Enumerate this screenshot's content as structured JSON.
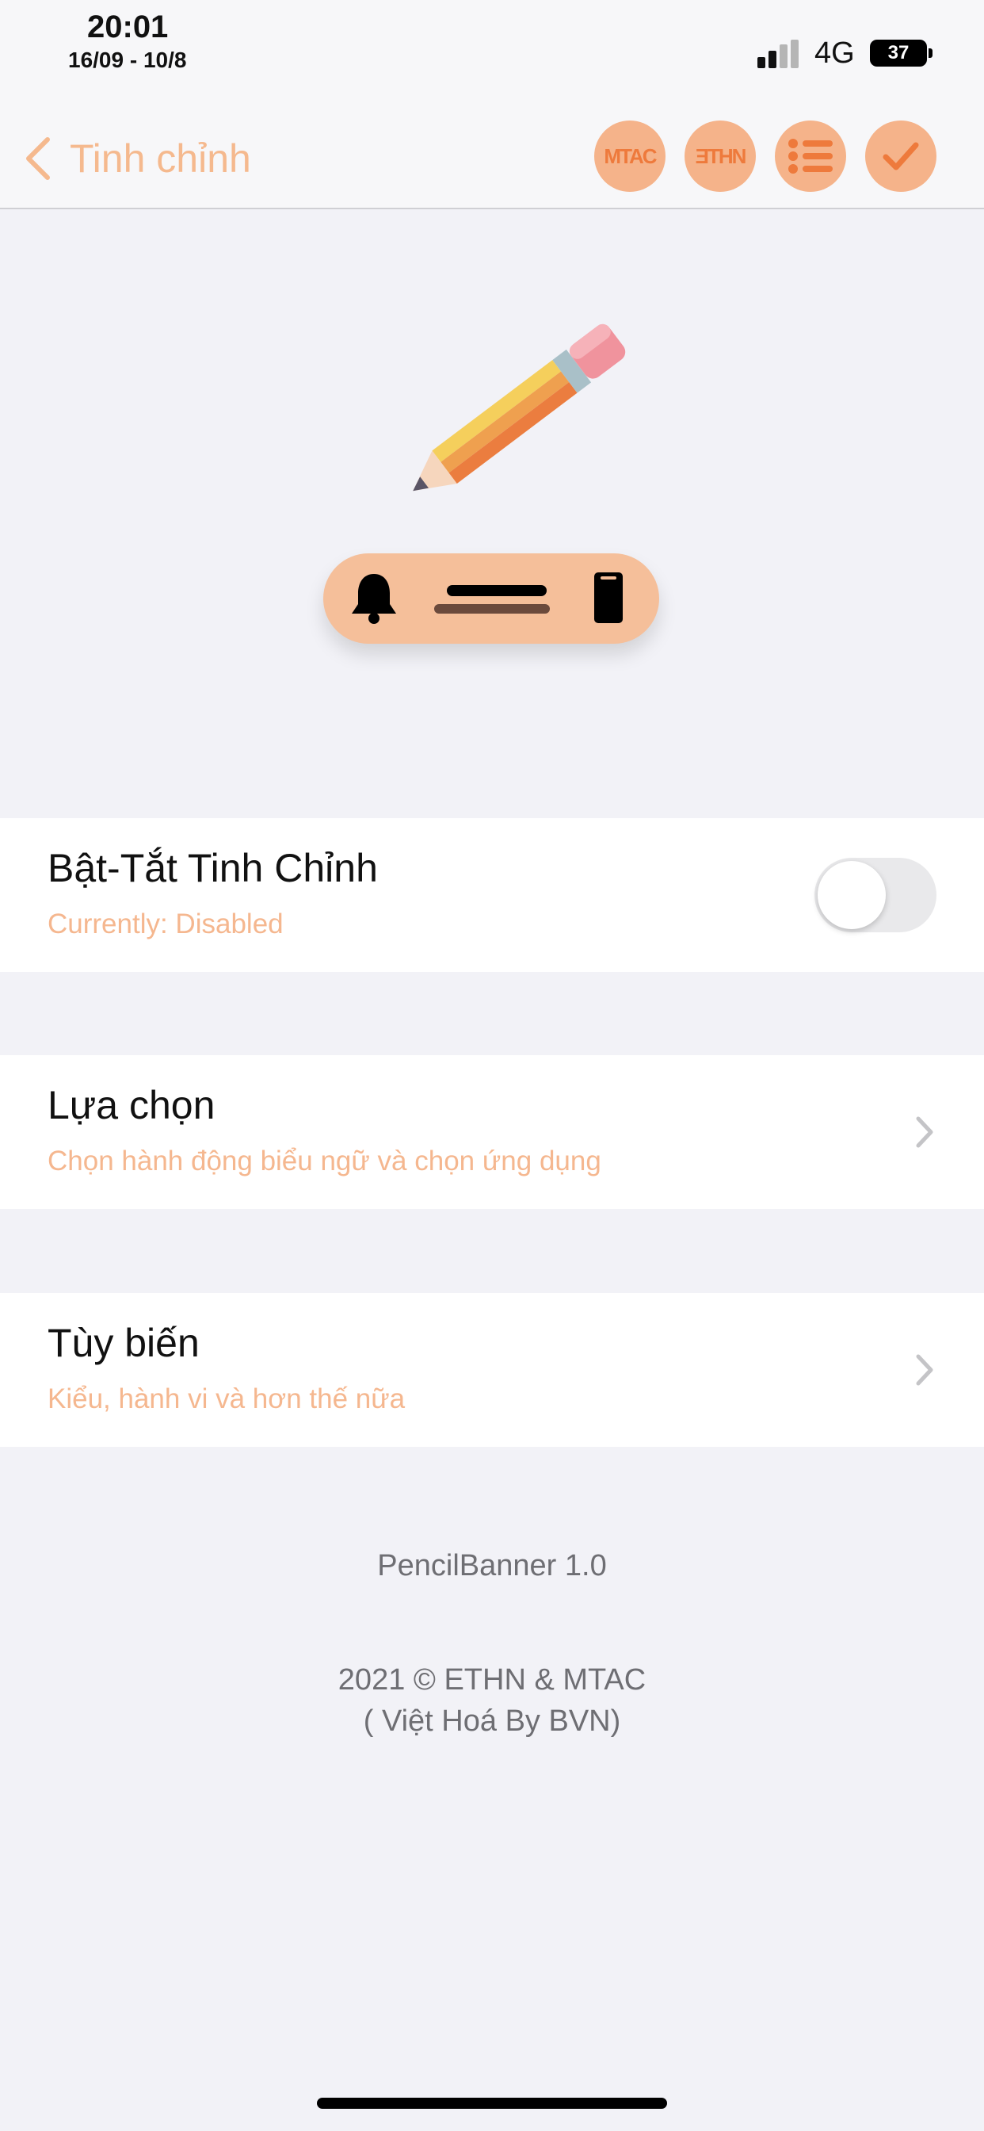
{
  "status_bar": {
    "time": "20:01",
    "date": "16/09 - 10/8",
    "network": "4G",
    "battery": "37"
  },
  "nav": {
    "back_label": "Tinh chỉnh",
    "buttons": [
      "MTAC",
      "ƎTHN"
    ],
    "accent_color": "#f5b38a"
  },
  "cells": {
    "toggle": {
      "title": "Bật-Tắt Tinh Chỉnh",
      "subtitle": "Currently: Disabled",
      "enabled": false
    },
    "options": {
      "title": "Lựa chọn",
      "subtitle": "Chọn hành động biểu ngữ và chọn ứng dụng"
    },
    "customize": {
      "title": "Tùy biến",
      "subtitle": "Kiểu, hành vi và hơn thế nữa"
    }
  },
  "footer": {
    "version": "PencilBanner 1.0",
    "copyright": "2021 © ETHN & MTAC",
    "credit": "( Việt Hoá By BVN)"
  }
}
